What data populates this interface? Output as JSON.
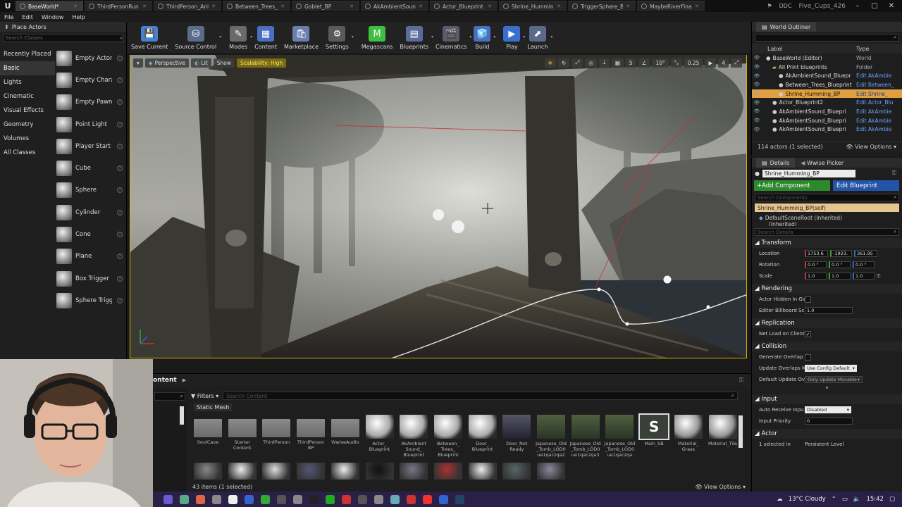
{
  "tabs": [
    {
      "label": "BaseWorld*",
      "active": true
    },
    {
      "label": "ThirdPersonRun"
    },
    {
      "label": "ThirdPerson_Anim"
    },
    {
      "label": "Between_Trees_Bl"
    },
    {
      "label": "Goblet_BP"
    },
    {
      "label": "AkAmbientSound_"
    },
    {
      "label": "Actor_Blueprint"
    },
    {
      "label": "Shrine_Humming_E"
    },
    {
      "label": "TriggerSphere_Blu"
    },
    {
      "label": "MaybeRiverFinal"
    }
  ],
  "titlebar": {
    "ddc": "DDC",
    "project": "Five_Cups_426"
  },
  "menu": [
    "File",
    "Edit",
    "Window",
    "Help"
  ],
  "place_actors": {
    "title": "Place Actors",
    "search_placeholder": "Search Classes",
    "categories": [
      "Recently Placed",
      "Basic",
      "Lights",
      "Cinematic",
      "Visual Effects",
      "Geometry",
      "Volumes",
      "All Classes"
    ],
    "selected_category": "Basic",
    "items": [
      "Empty Actor",
      "Empty Chara",
      "Empty Pawn",
      "Point Light",
      "Player Start",
      "Cube",
      "Sphere",
      "Cylinder",
      "Cone",
      "Plane",
      "Box Trigger",
      "Sphere Trigg"
    ]
  },
  "toolbar": [
    {
      "label": "Save Current",
      "icon": "save-icon",
      "color": "#4a7fd0"
    },
    {
      "label": "Source Control",
      "icon": "source-control-icon",
      "color": "#5a6c8a"
    },
    {
      "label": "Modes",
      "icon": "modes-icon",
      "color": "#6a6a6a"
    },
    {
      "label": "Content",
      "icon": "content-icon",
      "color": "#4a6fc0"
    },
    {
      "label": "Marketplace",
      "icon": "marketplace-icon",
      "color": "#6a7fb0"
    },
    {
      "label": "Settings",
      "icon": "gear-icon",
      "color": "#5a5a5a"
    },
    {
      "label": "Megascans",
      "icon": "megascans-icon",
      "color": "#3fbf3f"
    },
    {
      "label": "Blueprints",
      "icon": "blueprints-icon",
      "color": "#5a6c9a"
    },
    {
      "label": "Cinematics",
      "icon": "cinematics-icon",
      "color": "#5a5a6a"
    },
    {
      "label": "Build",
      "icon": "build-icon",
      "color": "#4a6fc0"
    },
    {
      "label": "Play",
      "icon": "play-icon",
      "color": "#3a6fd0"
    },
    {
      "label": "Launch",
      "icon": "launch-icon",
      "color": "#5a6a8a"
    }
  ],
  "viewport": {
    "perspective": "Perspective",
    "lit": "Lit",
    "show": "Show",
    "scalability": "Scalability: High",
    "snap_grid": "5",
    "snap_rot": "10°",
    "snap_scale": "0.25",
    "cam_speed": "4"
  },
  "outliner": {
    "title": "World Outliner",
    "col_label": "Label",
    "col_type": "Type",
    "rows": [
      {
        "name": "BaseWorld (Editor)",
        "type": "World",
        "indent": 0
      },
      {
        "name": "All Print blueprints",
        "type": "Folder",
        "indent": 1
      },
      {
        "name": "AkAmbientSound_Bluepr",
        "type": "Edit AkAmbie",
        "indent": 2
      },
      {
        "name": "Between_Trees_Blueprint",
        "type": "Edit Between_",
        "indent": 2
      },
      {
        "name": "Shrine_Humming_BP",
        "type": "Edit Shrine_",
        "indent": 2,
        "selected": true
      },
      {
        "name": "Actor_Blueprint2",
        "type": "Edit Actor_Blu",
        "indent": 1
      },
      {
        "name": "AkAmbientSound_Bluepri",
        "type": "Edit AkAmbie",
        "indent": 1
      },
      {
        "name": "AkAmbientSound_Bluepri",
        "type": "Edit AkAmbie",
        "indent": 1
      },
      {
        "name": "AkAmbientSound_Bluepri",
        "type": "Edit AkAmbie",
        "indent": 1
      }
    ],
    "status": "114 actors (1 selected)",
    "view_options": "View Options"
  },
  "details": {
    "tab_details": "Details",
    "tab_wwise": "Wwise Picker",
    "name": "Shrine_Humming_BP",
    "add_component": "+Add Component",
    "edit_blueprint": "Edit Blueprint",
    "search_components": "Search Components",
    "self": "Shrine_Humming_BP(self)",
    "root": "DefaultSceneRoot (Inherited)",
    "inherited": "(Inherited)",
    "search_details": "Search Details",
    "transform": "Transform",
    "location_label": "Location",
    "location": [
      "1753.6",
      "-1923.",
      "361.95"
    ],
    "rotation_label": "Rotation",
    "rotation": [
      "0.0 °",
      "0.0 °",
      "0.0 °"
    ],
    "scale_label": "Scale",
    "scale": [
      "1.0",
      "1.0",
      "1.0"
    ],
    "rendering": "Rendering",
    "hidden_label": "Actor Hidden In Ga",
    "billboard_label": "Editor Billboard Sc",
    "billboard_value": "1.0",
    "replication": "Replication",
    "net_load_label": "Net Load on Client",
    "collision": "Collision",
    "gen_overlap_label": "Generate Overlap",
    "update_overlaps_label": "Update Overlaps M",
    "update_overlaps_value": "Use Config Default",
    "default_update_label": "Default Update Ov",
    "default_update_value": "Only Update Movable",
    "input": "Input",
    "auto_receive_label": "Auto Receive Inpu",
    "auto_receive_value": "Disabled",
    "input_priority_label": "Input Priority",
    "input_priority_value": "0",
    "actor": "Actor",
    "selected_in": "1 selected in",
    "persistent_level": "Persistent Level"
  },
  "content_browser": {
    "title": "ontent",
    "filters": "Filters",
    "search_placeholder": "Search Content",
    "chip": "Static Mesh",
    "assets_row1": [
      {
        "name": "SoulCave",
        "kind": "folder"
      },
      {
        "name": "Starter Content",
        "kind": "folder"
      },
      {
        "name": "ThirdPerson",
        "kind": "folder"
      },
      {
        "name": "ThirdPerson BP",
        "kind": "folder"
      },
      {
        "name": "WwiseAudio",
        "kind": "folder"
      },
      {
        "name": "Actor_ Blueprint",
        "kind": "sphere"
      },
      {
        "name": "AkAmbient Sound_ Blueprint",
        "kind": "sphere"
      },
      {
        "name": "Between_ Trees_ Blueprint",
        "kind": "sphere"
      },
      {
        "name": "Door_ Blueprint",
        "kind": "sphere"
      },
      {
        "name": "Door_Not Ready",
        "kind": "door"
      },
      {
        "name": "Japanese_Old _Tomb_LOD0 ue1qaczqa2",
        "kind": "tomb"
      },
      {
        "name": "Japanese_Old _Tomb_LOD0 ue1qaczqa3",
        "kind": "tomb"
      },
      {
        "name": "Japanese_Old _Tomb_LOD0 ue1qaczqa",
        "kind": "tomb"
      },
      {
        "name": "Main_SB",
        "kind": "sb",
        "selected": true
      },
      {
        "name": "Material_ Grass",
        "kind": "mat"
      },
      {
        "name": "Material_Tile",
        "kind": "mat"
      }
    ],
    "status": "43 items (1 selected)",
    "view_options": "View Options"
  },
  "taskbar": {
    "weather": "13°C Cloudy",
    "time": "15:42"
  }
}
